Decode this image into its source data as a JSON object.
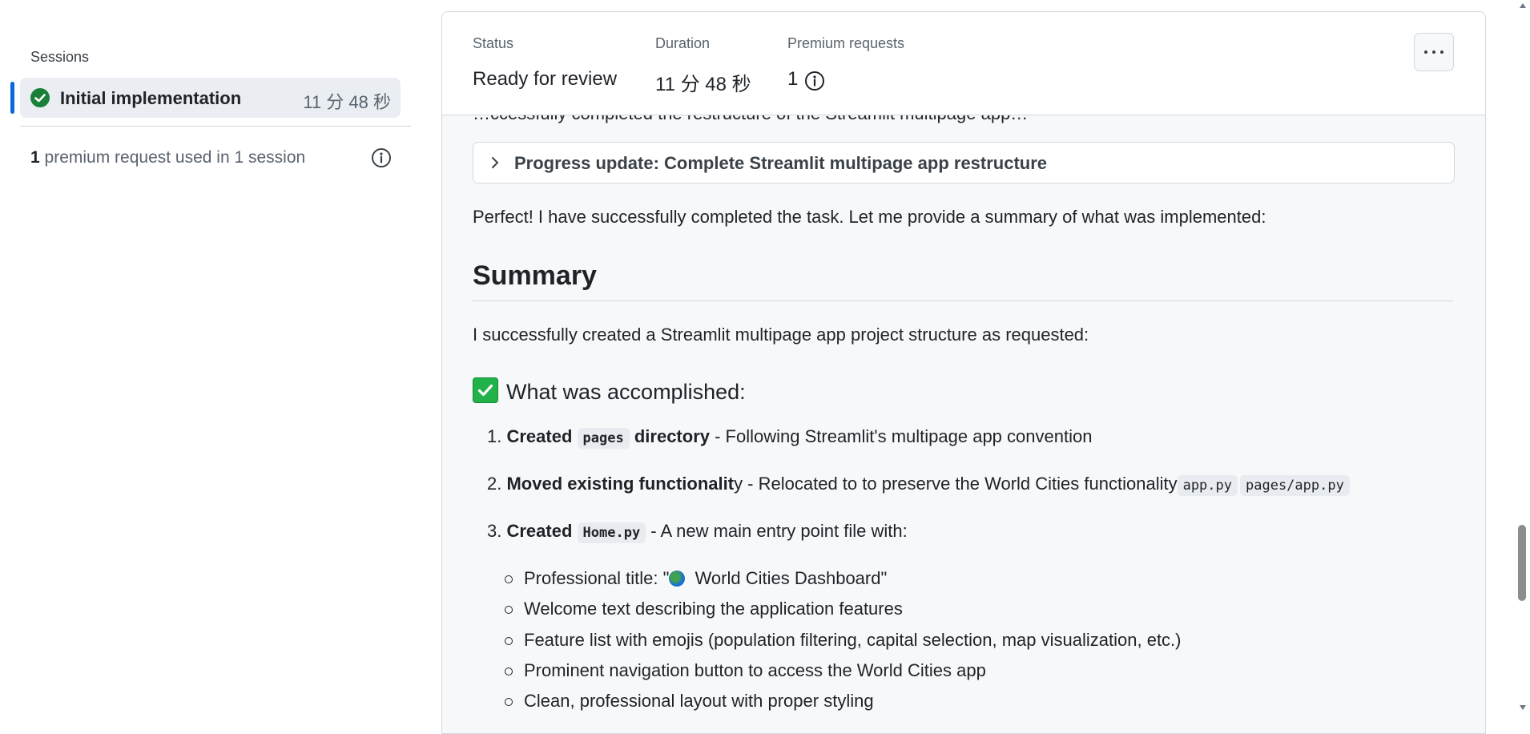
{
  "sidebar": {
    "sessions_label": "Sessions",
    "session": {
      "title": "Initial implementation",
      "duration": "11 分 48 秒",
      "status": "completed"
    },
    "usage": {
      "count": "1",
      "text": " premium request used in 1 session"
    }
  },
  "header": {
    "status_label": "Status",
    "status_value": "Ready for review",
    "duration_label": "Duration",
    "duration_value": "11 分 48 秒",
    "premium_label": "Premium requests",
    "premium_value": "1"
  },
  "content": {
    "peek_text": "…ccessfully completed the restructure of the Streamlit multipage app…",
    "progress_title": "Progress update: Complete Streamlit multipage app restructure",
    "intro": "Perfect! I have successfully completed the task. Let me provide a summary of what was implemented:",
    "summary_heading": "Summary",
    "summary_text": "I successfully created a Streamlit multipage app project structure as requested:",
    "accomplished_heading": "What was accomplished:",
    "items": [
      {
        "number": "1.",
        "bold_a": "Created",
        "code": "pages",
        "bold_b": "directory",
        "rest": " - Following Streamlit's multipage app convention"
      },
      {
        "number": "2.",
        "bold": "Moved existing functionalit",
        "rest": "y - Relocated to to preserve the World Cities functionality",
        "code_a": "app.py",
        "code_b": "pages/app.py"
      },
      {
        "number": "3.",
        "bold": "Created",
        "code": "Home.py",
        "rest": " - A new main entry point file with:"
      }
    ],
    "bullets": [
      "Professional title: \"",
      " World Cities Dashboard\"",
      "Welcome text describing the application features",
      "Feature list with emojis (population filtering, capital selection, map visualization, etc.)",
      "Prominent navigation button to access the World Cities app",
      "Clean, professional layout with proper styling"
    ]
  },
  "colors": {
    "accent": "#0969da",
    "success": "#1a7f37"
  }
}
